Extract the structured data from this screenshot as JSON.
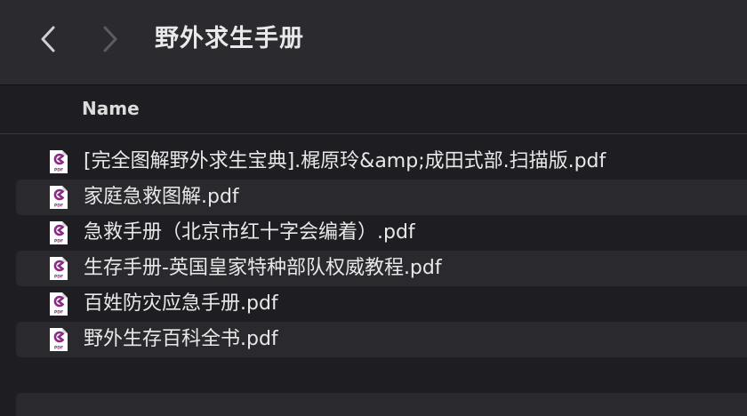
{
  "window": {
    "title": "野外求生手册"
  },
  "toolbar": {
    "back_icon": "chevron-left-icon",
    "forward_icon": "chevron-right-icon"
  },
  "columns": {
    "name": "Name"
  },
  "files": [
    {
      "name": "[完全图解野外求生宝典].梶原玲&amp;成田式部.扫描版.pdf",
      "icon": "pdf-file-icon"
    },
    {
      "name": "家庭急救图解.pdf",
      "icon": "pdf-file-icon"
    },
    {
      "name": "急救手册（北京市红十字会编着）.pdf",
      "icon": "pdf-file-icon"
    },
    {
      "name": "生存手册-英国皇家特种部队权威教程.pdf",
      "icon": "pdf-file-icon"
    },
    {
      "name": "百姓防灾应急手册.pdf",
      "icon": "pdf-file-icon"
    },
    {
      "name": "野外生存百科全书.pdf",
      "icon": "pdf-file-icon"
    }
  ],
  "colors": {
    "titlebar": "#2b2a2f",
    "background": "#1e1d22",
    "stripe": "#2a292e",
    "pdf_accent": "#8a2a86"
  }
}
